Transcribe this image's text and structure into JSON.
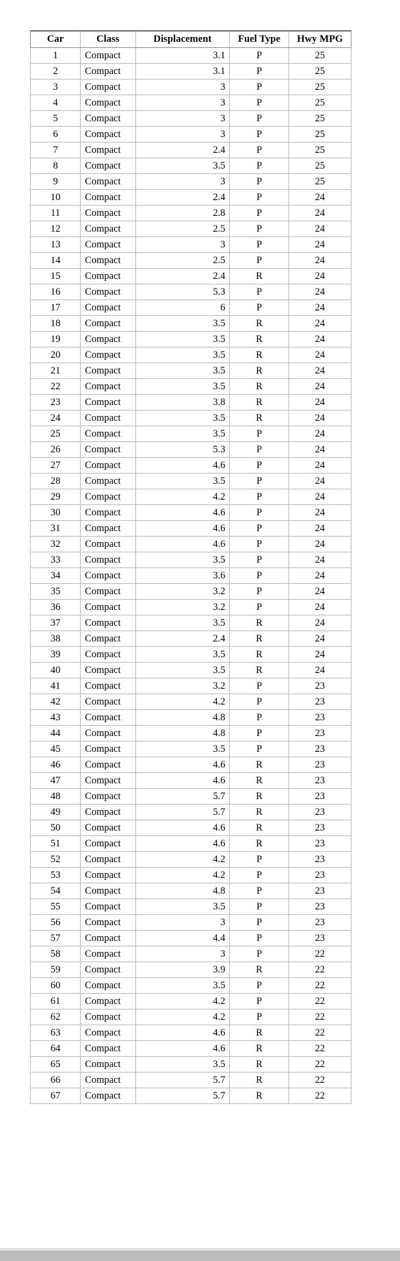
{
  "table": {
    "name": "car-fuel-economy-table",
    "columns": [
      {
        "key": "car",
        "label": "Car",
        "align": "center"
      },
      {
        "key": "class",
        "label": "Class",
        "align": "left"
      },
      {
        "key": "disp",
        "label": "Displacement",
        "align": "right"
      },
      {
        "key": "fuel",
        "label": "Fuel Type",
        "align": "center"
      },
      {
        "key": "mpg",
        "label": "Hwy MPG",
        "align": "center"
      }
    ],
    "rows": [
      [
        "1",
        "Compact",
        "3.1",
        "P",
        "25"
      ],
      [
        "2",
        "Compact",
        "3.1",
        "P",
        "25"
      ],
      [
        "3",
        "Compact",
        "3",
        "P",
        "25"
      ],
      [
        "4",
        "Compact",
        "3",
        "P",
        "25"
      ],
      [
        "5",
        "Compact",
        "3",
        "P",
        "25"
      ],
      [
        "6",
        "Compact",
        "3",
        "P",
        "25"
      ],
      [
        "7",
        "Compact",
        "2.4",
        "P",
        "25"
      ],
      [
        "8",
        "Compact",
        "3.5",
        "P",
        "25"
      ],
      [
        "9",
        "Compact",
        "3",
        "P",
        "25"
      ],
      [
        "10",
        "Compact",
        "2.4",
        "P",
        "24"
      ],
      [
        "11",
        "Compact",
        "2.8",
        "P",
        "24"
      ],
      [
        "12",
        "Compact",
        "2.5",
        "P",
        "24"
      ],
      [
        "13",
        "Compact",
        "3",
        "P",
        "24"
      ],
      [
        "14",
        "Compact",
        "2.5",
        "P",
        "24"
      ],
      [
        "15",
        "Compact",
        "2.4",
        "R",
        "24"
      ],
      [
        "16",
        "Compact",
        "5.3",
        "P",
        "24"
      ],
      [
        "17",
        "Compact",
        "6",
        "P",
        "24"
      ],
      [
        "18",
        "Compact",
        "3.5",
        "R",
        "24"
      ],
      [
        "19",
        "Compact",
        "3.5",
        "R",
        "24"
      ],
      [
        "20",
        "Compact",
        "3.5",
        "R",
        "24"
      ],
      [
        "21",
        "Compact",
        "3.5",
        "R",
        "24"
      ],
      [
        "22",
        "Compact",
        "3.5",
        "R",
        "24"
      ],
      [
        "23",
        "Compact",
        "3.8",
        "R",
        "24"
      ],
      [
        "24",
        "Compact",
        "3.5",
        "R",
        "24"
      ],
      [
        "25",
        "Compact",
        "3.5",
        "P",
        "24"
      ],
      [
        "26",
        "Compact",
        "5.3",
        "P",
        "24"
      ],
      [
        "27",
        "Compact",
        "4.6",
        "P",
        "24"
      ],
      [
        "28",
        "Compact",
        "3.5",
        "P",
        "24"
      ],
      [
        "29",
        "Compact",
        "4.2",
        "P",
        "24"
      ],
      [
        "30",
        "Compact",
        "4.6",
        "P",
        "24"
      ],
      [
        "31",
        "Compact",
        "4.6",
        "P",
        "24"
      ],
      [
        "32",
        "Compact",
        "4.6",
        "P",
        "24"
      ],
      [
        "33",
        "Compact",
        "3.5",
        "P",
        "24"
      ],
      [
        "34",
        "Compact",
        "3.6",
        "P",
        "24"
      ],
      [
        "35",
        "Compact",
        "3.2",
        "P",
        "24"
      ],
      [
        "36",
        "Compact",
        "3.2",
        "P",
        "24"
      ],
      [
        "37",
        "Compact",
        "3.5",
        "R",
        "24"
      ],
      [
        "38",
        "Compact",
        "2.4",
        "R",
        "24"
      ],
      [
        "39",
        "Compact",
        "3.5",
        "R",
        "24"
      ],
      [
        "40",
        "Compact",
        "3.5",
        "R",
        "24"
      ],
      [
        "41",
        "Compact",
        "3.2",
        "P",
        "23"
      ],
      [
        "42",
        "Compact",
        "4.2",
        "P",
        "23"
      ],
      [
        "43",
        "Compact",
        "4.8",
        "P",
        "23"
      ],
      [
        "44",
        "Compact",
        "4.8",
        "P",
        "23"
      ],
      [
        "45",
        "Compact",
        "3.5",
        "P",
        "23"
      ],
      [
        "46",
        "Compact",
        "4.6",
        "R",
        "23"
      ],
      [
        "47",
        "Compact",
        "4.6",
        "R",
        "23"
      ],
      [
        "48",
        "Compact",
        "5.7",
        "R",
        "23"
      ],
      [
        "49",
        "Compact",
        "5.7",
        "R",
        "23"
      ],
      [
        "50",
        "Compact",
        "4.6",
        "R",
        "23"
      ],
      [
        "51",
        "Compact",
        "4.6",
        "R",
        "23"
      ],
      [
        "52",
        "Compact",
        "4.2",
        "P",
        "23"
      ],
      [
        "53",
        "Compact",
        "4.2",
        "P",
        "23"
      ],
      [
        "54",
        "Compact",
        "4.8",
        "P",
        "23"
      ],
      [
        "55",
        "Compact",
        "3.5",
        "P",
        "23"
      ],
      [
        "56",
        "Compact",
        "3",
        "P",
        "23"
      ],
      [
        "57",
        "Compact",
        "4.4",
        "P",
        "23"
      ],
      [
        "58",
        "Compact",
        "3",
        "P",
        "22"
      ],
      [
        "59",
        "Compact",
        "3.9",
        "R",
        "22"
      ],
      [
        "60",
        "Compact",
        "3.5",
        "P",
        "22"
      ],
      [
        "61",
        "Compact",
        "4.2",
        "P",
        "22"
      ],
      [
        "62",
        "Compact",
        "4.2",
        "P",
        "22"
      ],
      [
        "63",
        "Compact",
        "4.6",
        "R",
        "22"
      ],
      [
        "64",
        "Compact",
        "4.6",
        "R",
        "22"
      ],
      [
        "65",
        "Compact",
        "3.5",
        "R",
        "22"
      ],
      [
        "66",
        "Compact",
        "5.7",
        "R",
        "22"
      ],
      [
        "67",
        "Compact",
        "5.7",
        "R",
        "22"
      ]
    ]
  },
  "colors": {
    "grid_line": "#b9b9b9",
    "header_rule": "#6f6f6f",
    "text": "#000000",
    "page_background": "#ffffff",
    "bottom_bar": "#b6b6b6"
  }
}
